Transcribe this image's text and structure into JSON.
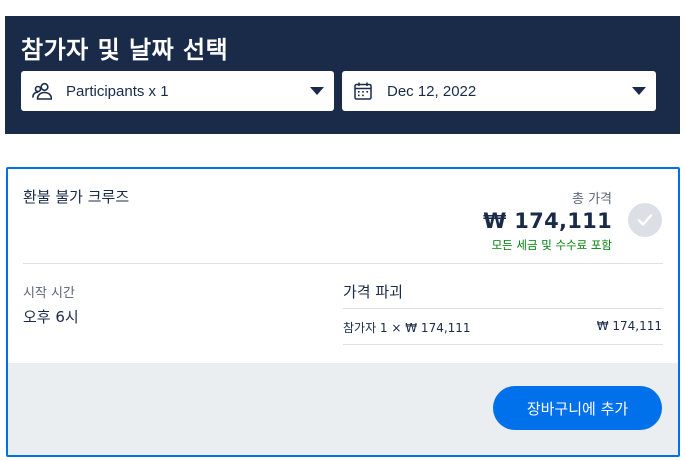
{
  "header": {
    "title": "참가자 및 날짜 선택",
    "participants_select": {
      "label": "Participants x 1",
      "icon": "people-icon"
    },
    "date_select": {
      "label": "Dec 12, 2022",
      "icon": "calendar-icon"
    }
  },
  "option": {
    "title": "환불 불가 크루즈",
    "price_label": "총 가격",
    "price": "₩ 174,111",
    "tax_note": "모든 세금 및 수수료 포함",
    "start_time_label": "시작 시간",
    "start_time_value": "오후 6시",
    "breakdown_title": "가격 파괴",
    "breakdown_line": "참가자 1 × ₩ 174,111",
    "breakdown_amount": "₩ 174,111",
    "add_to_cart_label": "장바구니에 추가"
  },
  "colors": {
    "header_bg": "#1a2b49",
    "accent": "#0071eb",
    "tax_note": "#008009",
    "footer_bg": "#ebeef1"
  }
}
